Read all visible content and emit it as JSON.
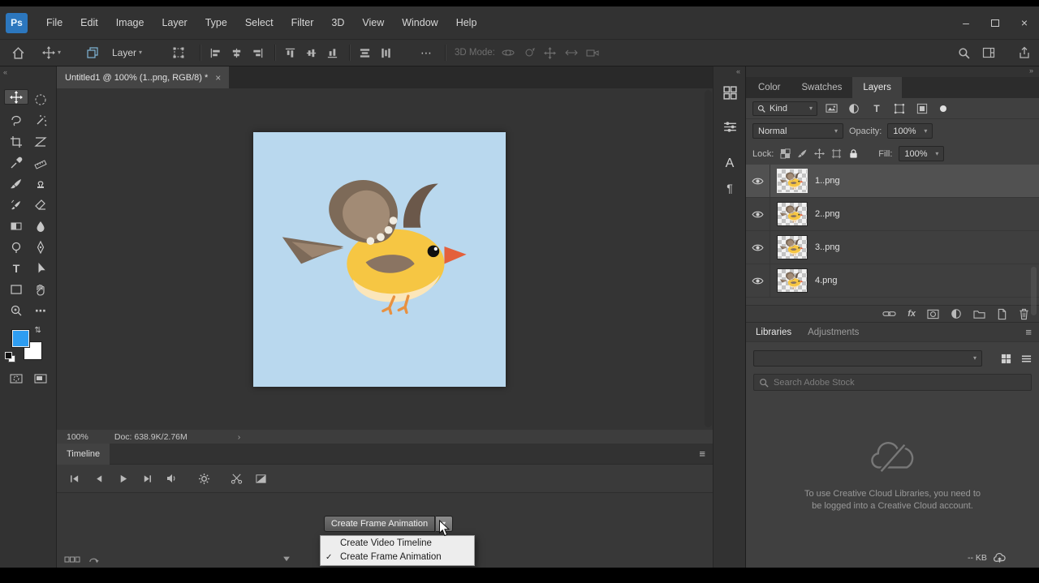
{
  "icons": {
    "hamburger": "≡",
    "caret_down": "▾",
    "collapse_left": "«",
    "collapse_right": "»",
    "ellipsis": "⋯",
    "check": "✓",
    "swap_colors": "⇄",
    "chevron_right": "›",
    "type_tool": "T",
    "character_panel": "A",
    "paragraph_panel": "¶",
    "minimize": "–",
    "close": "×"
  },
  "menu": {
    "logo": "Ps",
    "items": [
      "File",
      "Edit",
      "Image",
      "Layer",
      "Type",
      "Select",
      "Filter",
      "3D",
      "View",
      "Window",
      "Help"
    ]
  },
  "options": {
    "auto_select_value": "Layer",
    "three_d_label": "3D Mode:"
  },
  "document": {
    "tab_title": "Untitled1 @ 100% (1..png, RGB/8) *",
    "close_label": "×",
    "zoom_level": "100%",
    "doc_info": "Doc: 638.9K/2.76M"
  },
  "timeline": {
    "tab_label": "Timeline",
    "create_button_label": "Create Frame Animation",
    "dropdown_items": [
      {
        "label": "Create Video Timeline",
        "check": ""
      },
      {
        "label": "Create Frame Animation",
        "check": "✓"
      }
    ]
  },
  "panels": {
    "tabs": [
      "Color",
      "Swatches",
      "Layers"
    ],
    "layers": {
      "filter_kind": "Kind",
      "blend_mode": "Normal",
      "opacity_label": "Opacity:",
      "opacity_value": "100%",
      "lock_label": "Lock:",
      "fill_label": "Fill:",
      "fill_value": "100%",
      "fx_label": "fx",
      "items": [
        {
          "name": "1..png"
        },
        {
          "name": "2..png"
        },
        {
          "name": "3..png"
        },
        {
          "name": "4.png"
        }
      ]
    },
    "libraries": {
      "tab_active": "Libraries",
      "tab_inactive": "Adjustments",
      "search_placeholder": "Search Adobe Stock",
      "offline_message": "To use Creative Cloud Libraries, you need to be logged into a Creative Cloud account."
    }
  },
  "statusbar_right": {
    "size_label": "-- KB"
  },
  "colors": {
    "foreground_swatch": "#2e9df1",
    "canvas_blue": "#b9d8ee",
    "bird_yellow": "#f6c643",
    "bird_brown": "#7d6a58",
    "accent_blue": "#2c77be"
  }
}
